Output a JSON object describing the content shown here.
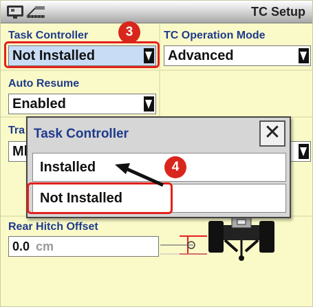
{
  "title_bar": {
    "title": "TC Setup",
    "icons": [
      "monitor-icon",
      "implement-icon"
    ]
  },
  "fields": {
    "task_controller": {
      "label": "Task Controller",
      "value": "Not Installed"
    },
    "tc_operation_mode": {
      "label": "TC Operation Mode",
      "value": "Advanced"
    },
    "auto_resume": {
      "label": "Auto Resume",
      "value": "Enabled"
    },
    "hidden_field": {
      "label_partial": "Tra",
      "value_partial": "Ml"
    },
    "rear_hitch_offset": {
      "label": "Rear Hitch Offset",
      "value": "0.0",
      "unit": "cm"
    }
  },
  "popup": {
    "title": "Task Controller",
    "close_symbol": "✕",
    "options": [
      "Installed",
      "Not Installed"
    ]
  },
  "callouts": {
    "step_three": "3",
    "step_four": "4"
  },
  "colors": {
    "label_blue": "#1e3a8c",
    "callout_red": "#e3211c",
    "background": "#fafac8",
    "selected_field": "#c9dcf5"
  }
}
